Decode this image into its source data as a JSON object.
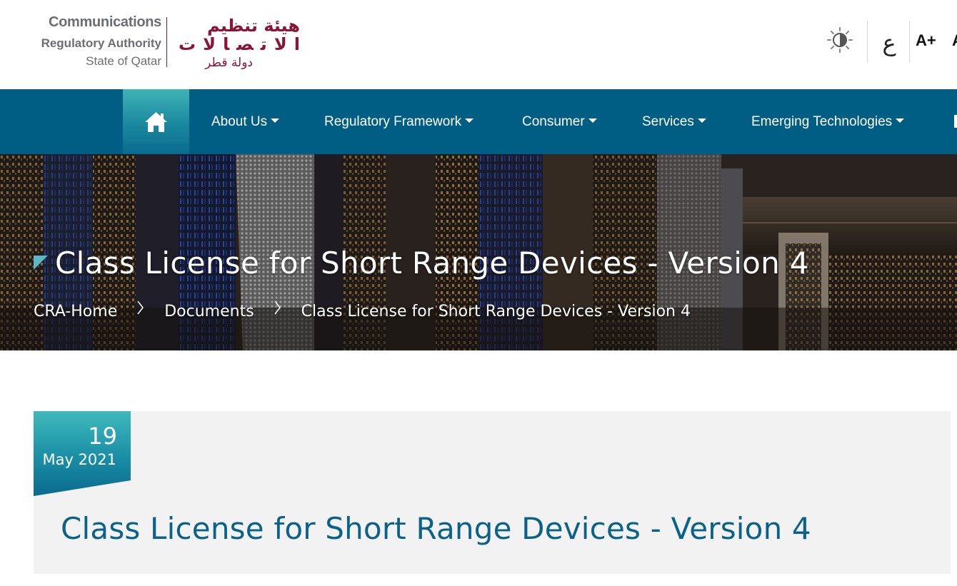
{
  "header": {
    "logo": {
      "en_line1": "Communications",
      "en_line2": "Regulatory Authority",
      "en_line3": "State of Qatar",
      "ar_line1": "هيئة تنظيم",
      "ar_line2": "الاتصالات",
      "ar_line3": "دولة قطر"
    },
    "theme_toggle_icon": "sun-icon",
    "language_label": "ع",
    "font_increase_label": "A+",
    "font_decrease_label": "A"
  },
  "nav": {
    "home_icon": "home-icon",
    "items": [
      {
        "label": "About Us"
      },
      {
        "label": "Regulatory Framework"
      },
      {
        "label": "Consumer"
      },
      {
        "label": "Services"
      },
      {
        "label": "Emerging Technologies"
      }
    ]
  },
  "banner": {
    "title": "Class License for Short Range Devices - Version 4",
    "breadcrumb": [
      "CRA-Home",
      "Documents",
      "Class License for Short Range Devices - Version 4"
    ]
  },
  "document": {
    "date_day": "19",
    "date_month_year": "May 2021",
    "title": "Class License for Short Range Devices - Version 4"
  },
  "colors": {
    "nav_bg": "#005d83",
    "accent_teal": "#3fb3b8",
    "title_blue": "#0b6289",
    "brand_maroon": "#8a1538",
    "card_bg": "#f2f2f2"
  }
}
